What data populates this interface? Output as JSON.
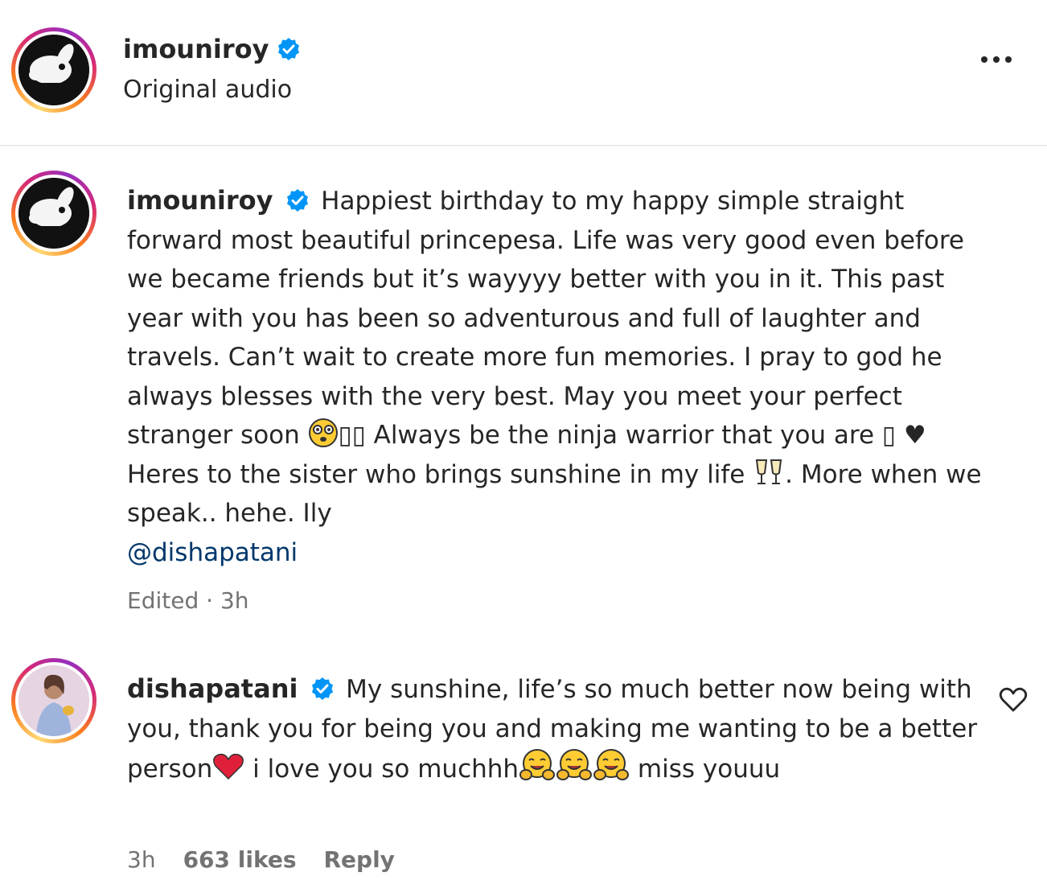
{
  "header": {
    "username": "imouniroy",
    "subtitle": "Original audio"
  },
  "caption": {
    "username": "imouniroy",
    "text_part1": "Happiest birthday to my happy simple straight forward most beautiful princepesa. Life was very good even before we became friends but it’s wayyyy better with you in it. This past year with you has been so adventurous and full of laughter and travels. Can’t wait to create more fun memories. I pray to god he always blesses with the very best. May you meet your perfect stranger soon ",
    "text_part2": "▯▯ Always be the ninja warrior that you are ▯ ♥ Heres to the sister who brings sunshine in my life ",
    "text_part3": ". More when we speak.. hehe. Ily",
    "mention": "@dishapatani",
    "edited": "Edited",
    "separator": " · ",
    "time": "3h"
  },
  "comment": {
    "username": "dishapatani",
    "text_part1": "My sunshine, life’s so much better now being with you, thank you for being you and making me wanting to be a better person",
    "text_part2": " i love you so muchhh",
    "text_part3": " miss youuu",
    "time": "3h",
    "likes": "663 likes",
    "reply": "Reply"
  },
  "icons": [
    "more-options-icon",
    "verified-badge-icon",
    "heart-outline-icon",
    "hugging-face-emoji",
    "red-heart-emoji",
    "clinking-glasses-emoji",
    "dizzy-face-emoji"
  ],
  "colors": {
    "verified": "#0095f6",
    "link": "#00376b",
    "meta": "#737373",
    "text": "#262626"
  }
}
